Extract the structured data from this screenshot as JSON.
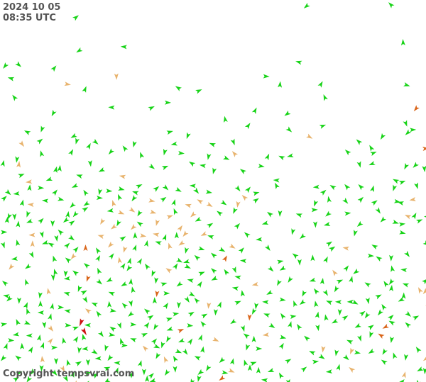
{
  "timestamp": {
    "date": "2024 10 05",
    "time": "08:35 UTC"
  },
  "copyright": "Copyright tempsvrai.com",
  "legend_colors": {
    "low": "#17d317",
    "medium": "#e8b36d",
    "high": "#d9651a",
    "very_high": "#cc1111"
  },
  "icon": "wind-arrow-icon"
}
